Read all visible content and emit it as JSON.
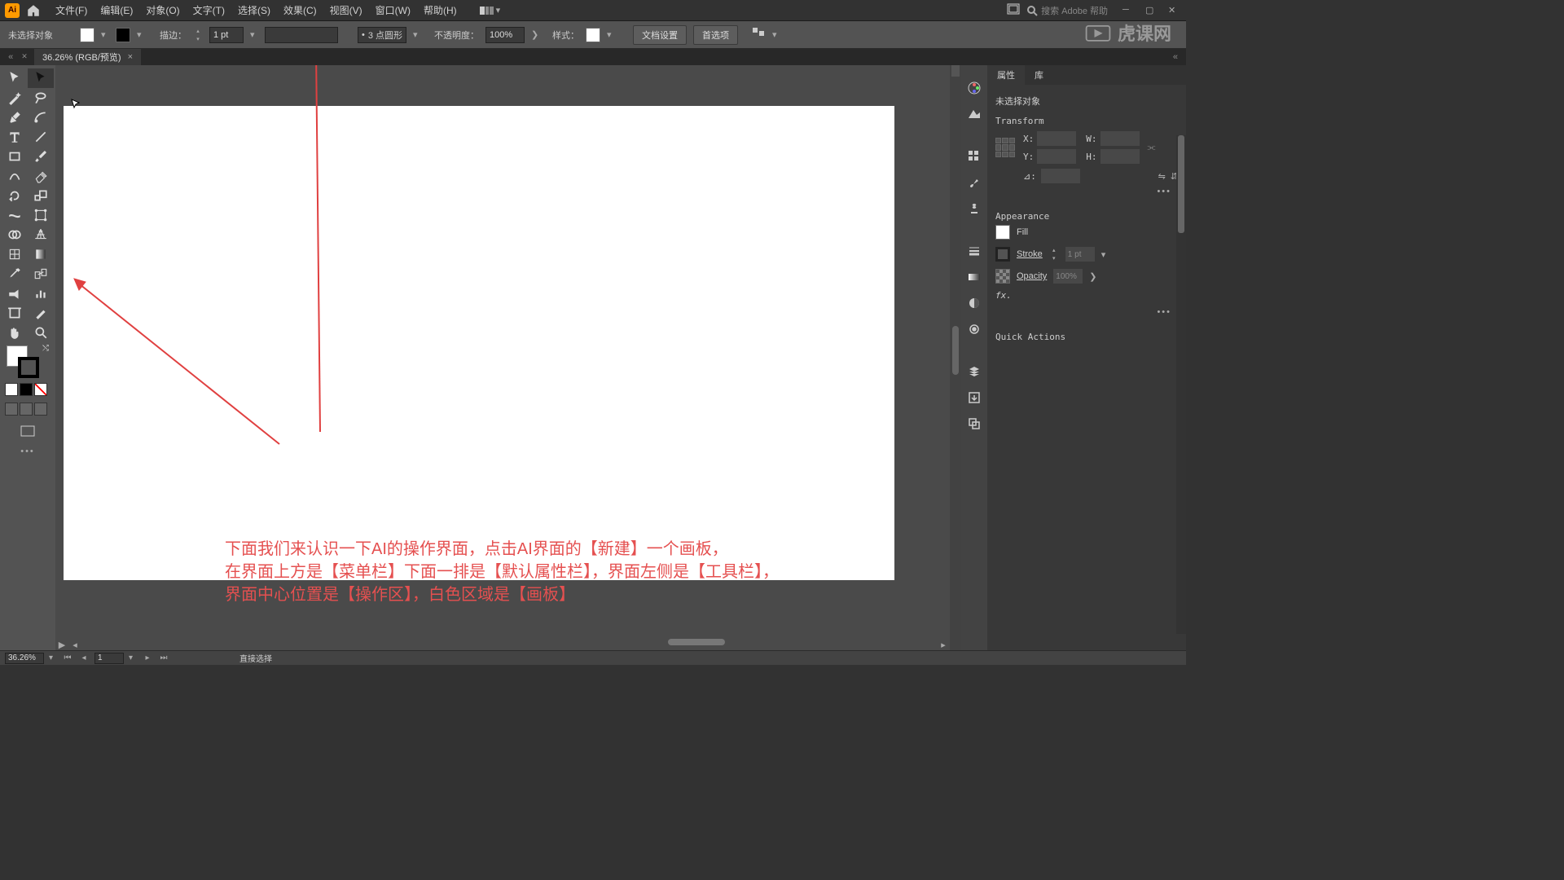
{
  "titlebar": {
    "app": "Ai",
    "menus": [
      "文件(F)",
      "编辑(E)",
      "对象(O)",
      "文字(T)",
      "选择(S)",
      "效果(C)",
      "视图(V)",
      "窗口(W)",
      "帮助(H)"
    ],
    "search_placeholder": "搜索 Adobe 帮助"
  },
  "watermark": "虎课网",
  "controlbar": {
    "noselect": "未选择对象",
    "stroke_label": "描边：",
    "stroke_val": "1 pt",
    "brush_val": "3 点圆形",
    "opacity_label": "不透明度：",
    "opacity_val": "100%",
    "style_label": "样式：",
    "doc_setup": "文档设置",
    "prefs": "首选项"
  },
  "doc_tab": "36.26% (RGB/预览)",
  "canvas": {
    "annot_line1": "下面我们来认识一下AI的操作界面，点击AI界面的【新建】一个画板，",
    "annot_line2": "在界面上方是【菜单栏】下面一排是【默认属性栏】，界面左侧是【工具栏】，",
    "annot_line3": "界面中心位置是【操作区】，白色区域是【画板】"
  },
  "panel": {
    "tab_props": "属性",
    "tab_lib": "库",
    "noselect": "未选择对象",
    "transform": "Transform",
    "x": "X:",
    "y": "Y:",
    "w": "W:",
    "h": "H:",
    "angle": "⊿:",
    "appearance": "Appearance",
    "fill": "Fill",
    "stroke": "Stroke",
    "stroke_val": "1 pt",
    "opacity": "Opacity",
    "opacity_val": "100%",
    "fx": "fx.",
    "quick": "Quick Actions"
  },
  "status": {
    "zoom": "36.26%",
    "artboard": "1",
    "tool": "直接选择"
  }
}
